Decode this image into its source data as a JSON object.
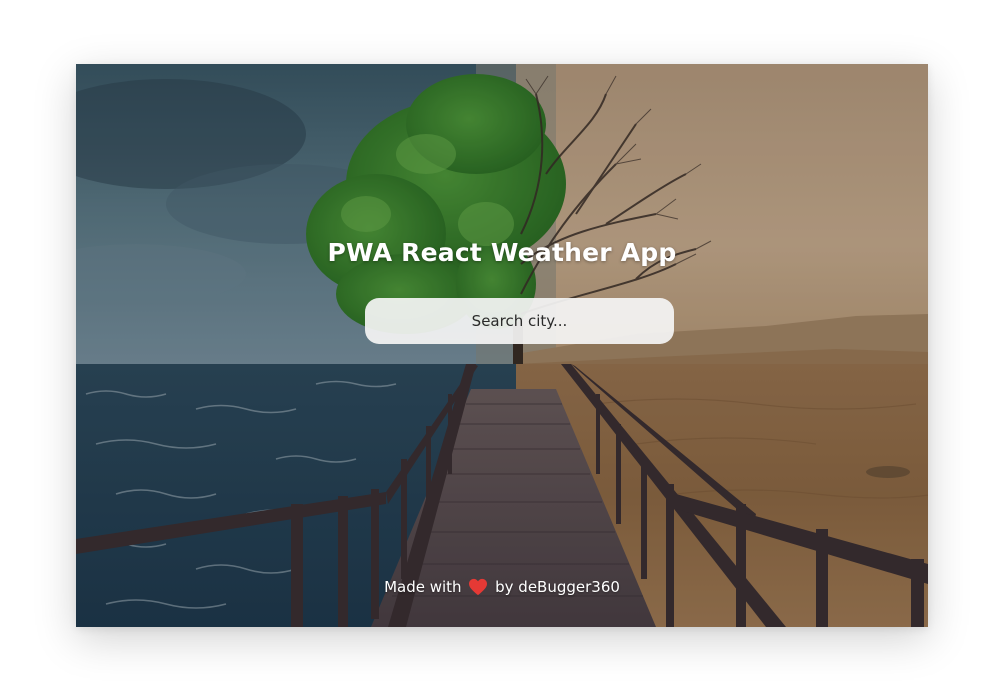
{
  "app": {
    "title": "PWA React Weather App"
  },
  "search": {
    "placeholder": "Search city..."
  },
  "footer": {
    "made_with": "Made with",
    "by_text": "by deBugger360",
    "heart_icon": "heart-icon",
    "heart_color": "#e53935"
  },
  "colors": {
    "title_text": "#ffffff",
    "search_bg": "#f5f5f5"
  }
}
